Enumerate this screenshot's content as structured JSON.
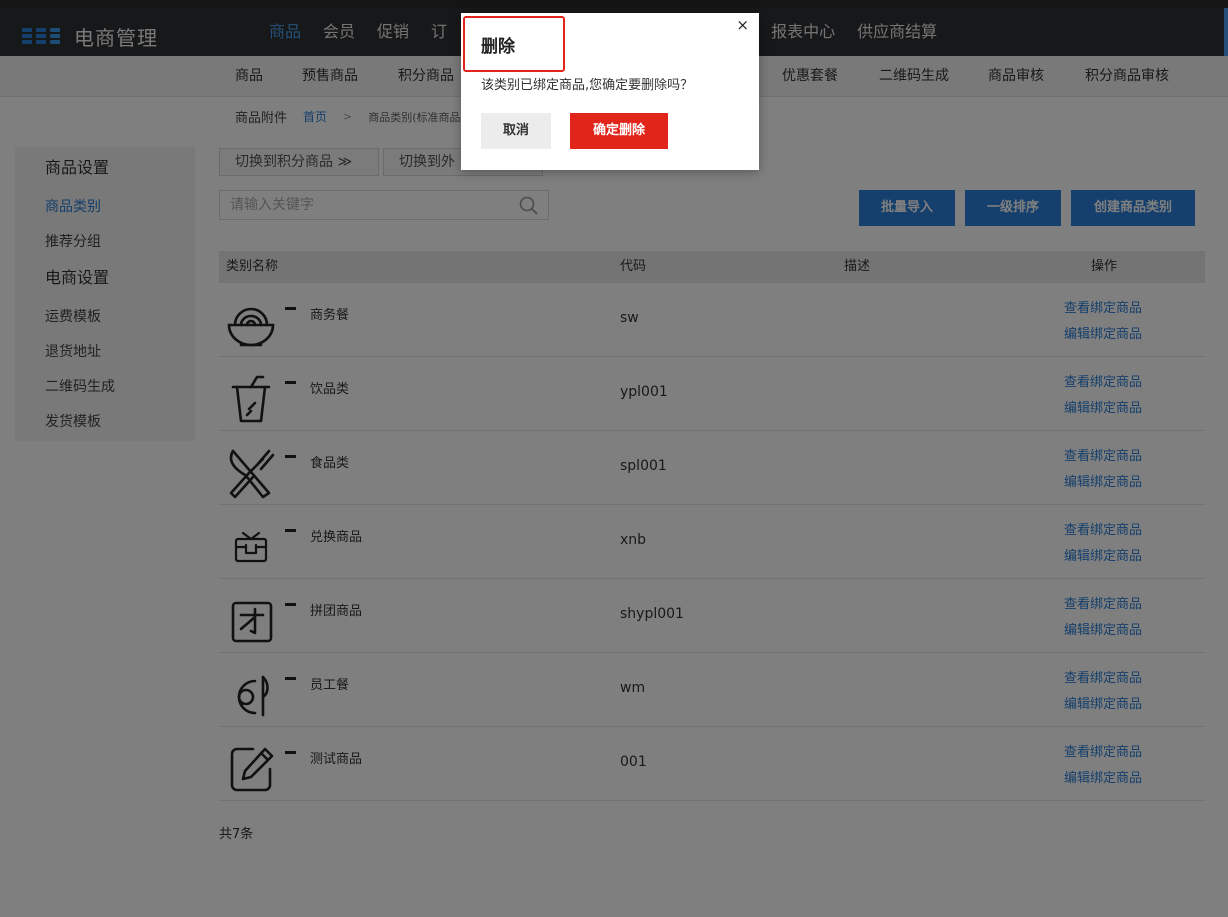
{
  "app": {
    "title": "电商管理"
  },
  "nav": {
    "items_left": [
      "商品",
      "会员",
      "促销",
      "订"
    ],
    "items_right": [
      "报表中心",
      "供应商结算"
    ]
  },
  "subnav": {
    "items": [
      "商品",
      "预售商品",
      "积分商品",
      "优惠套餐",
      "二维码生成",
      "商品审核",
      "积分商品审核"
    ]
  },
  "breadcrumb": {
    "section": "商品附件",
    "home": "首页",
    "sep": ">",
    "current": "商品类别(标准商品"
  },
  "sidebar": {
    "group1": "商品设置",
    "items1": [
      "商品类别",
      "推荐分组"
    ],
    "group2": "电商设置",
    "items2": [
      "运费模板",
      "退货地址",
      "二维码生成",
      "发货模板"
    ]
  },
  "toolbar": {
    "switch_points": "切换到积分商品 ≫",
    "switch_external": "切换到外",
    "search_placeholder": "请输入关键字",
    "import": "批量导入",
    "sort": "一级排序",
    "create": "创建商品类别"
  },
  "table": {
    "headers": [
      "类别名称",
      "代码",
      "描述",
      "操作"
    ],
    "action1": "查看绑定商品",
    "action2": "编辑绑定商品",
    "rows": [
      {
        "icon": "bowl-icon",
        "name": "商务餐",
        "code": "sw"
      },
      {
        "icon": "drink-cup-icon",
        "name": "饮品类",
        "code": "ypl001"
      },
      {
        "icon": "fork-knife-icon",
        "name": "食品类",
        "code": "spl001"
      },
      {
        "icon": "gift-box-icon",
        "name": "兑换商品",
        "code": "xnb"
      },
      {
        "icon": "group-buy-icon",
        "name": "拼团商品",
        "code": "shypl001"
      },
      {
        "icon": "plate-icon",
        "name": "员工餐",
        "code": "wm"
      },
      {
        "icon": "edit-icon",
        "name": "测试商品",
        "code": "001"
      }
    ],
    "total": "共7条"
  },
  "dialog": {
    "title": "删除",
    "close": "×",
    "message": "该类别已绑定商品,您确定要删除吗？",
    "cancel": "取消",
    "confirm": "确定删除"
  },
  "colors": {
    "accent": "#2b7fd8",
    "danger": "#e1251b",
    "header_bg": "#2f3033"
  }
}
